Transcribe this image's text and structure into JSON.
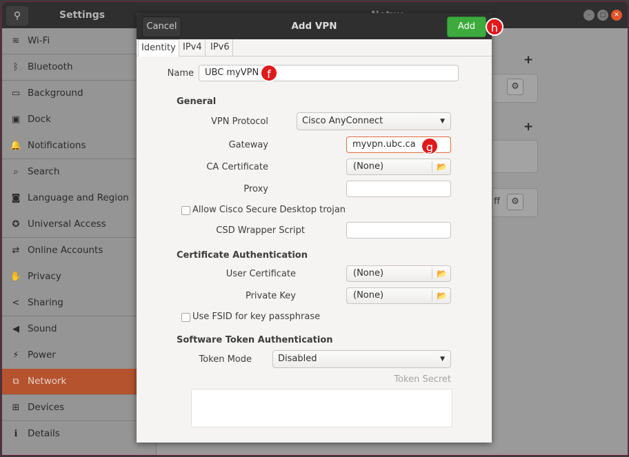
{
  "settings": {
    "title": "Settings",
    "panel_title": "Network",
    "sidebar": [
      {
        "label": "Wi-Fi",
        "icon": "wifi-icon",
        "glyph": "≋"
      },
      {
        "label": "Bluetooth",
        "icon": "bluetooth-icon",
        "glyph": "ᛒ"
      },
      {
        "label": "Background",
        "icon": "background-icon",
        "glyph": "▭"
      },
      {
        "label": "Dock",
        "icon": "dock-icon",
        "glyph": "▣"
      },
      {
        "label": "Notifications",
        "icon": "bell-icon",
        "glyph": "🔔"
      },
      {
        "label": "Search",
        "icon": "search-icon",
        "glyph": "⌕"
      },
      {
        "label": "Language and Region",
        "icon": "camera-icon",
        "glyph": "◙"
      },
      {
        "label": "Universal Access",
        "icon": "accessibility-icon",
        "glyph": "✪"
      },
      {
        "label": "Online Accounts",
        "icon": "online-accounts-icon",
        "glyph": "⇄"
      },
      {
        "label": "Privacy",
        "icon": "hand-icon",
        "glyph": "✋"
      },
      {
        "label": "Sharing",
        "icon": "share-icon",
        "glyph": "<"
      },
      {
        "label": "Sound",
        "icon": "speaker-icon",
        "glyph": "◀"
      },
      {
        "label": "Power",
        "icon": "power-icon",
        "glyph": "⚡"
      },
      {
        "label": "Network",
        "icon": "network-icon",
        "glyph": "⧉"
      },
      {
        "label": "Devices",
        "icon": "devices-icon",
        "glyph": "⊞"
      },
      {
        "label": "Details",
        "icon": "info-icon",
        "glyph": "ℹ"
      }
    ],
    "active_item": "Network",
    "behind_text": "ff"
  },
  "dialog": {
    "title": "Add VPN",
    "cancel_label": "Cancel",
    "add_label": "Add",
    "tabs": [
      "Identity",
      "IPv4",
      "IPv6"
    ],
    "active_tab": "Identity",
    "name_label": "Name",
    "name_value": "UBC myVPN",
    "general": {
      "heading": "General",
      "protocol_label": "VPN Protocol",
      "protocol_value": "Cisco AnyConnect",
      "gateway_label": "Gateway",
      "gateway_value": "myvpn.ubc.ca",
      "ca_label": "CA Certificate",
      "ca_value": "(None)",
      "proxy_label": "Proxy",
      "proxy_value": "",
      "trojan_label": "Allow Cisco Secure Desktop trojan",
      "trojan_checked": false,
      "csd_label": "CSD Wrapper Script",
      "csd_value": ""
    },
    "cert_auth": {
      "heading": "Certificate Authentication",
      "user_cert_label": "User Certificate",
      "user_cert_value": "(None)",
      "private_key_label": "Private Key",
      "private_key_value": "(None)",
      "fsid_label": "Use FSID for key passphrase",
      "fsid_checked": false
    },
    "token_auth": {
      "heading": "Software Token Authentication",
      "mode_label": "Token Mode",
      "mode_value": "Disabled",
      "secret_placeholder": "Token Secret"
    }
  },
  "annotations": {
    "f": "f",
    "g": "g",
    "h": "h",
    "color": "#e0191c"
  }
}
